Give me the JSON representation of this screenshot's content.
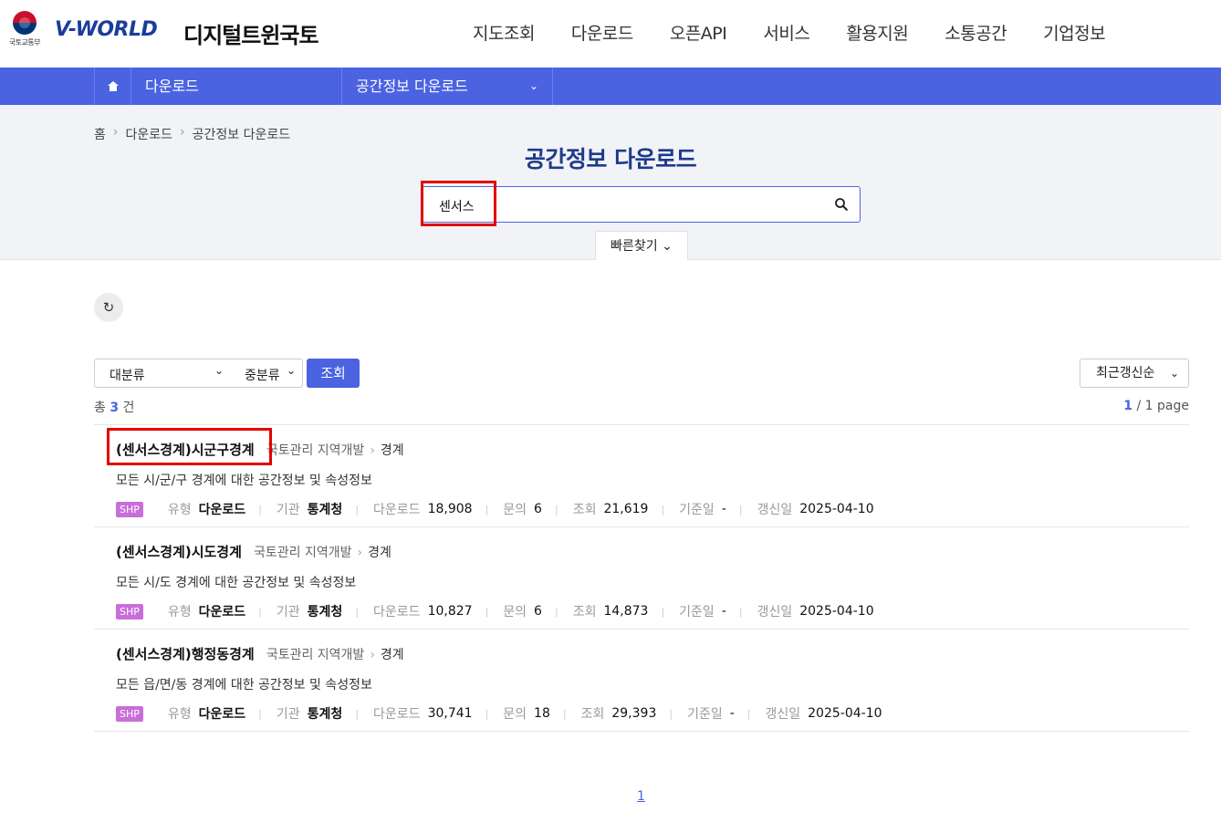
{
  "header": {
    "ministry_name": "국토교통부",
    "logo_text": "V-WORLD",
    "sub_brand": "디지털트윈국토",
    "nav": [
      "지도조회",
      "다운로드",
      "오픈API",
      "서비스",
      "활용지원",
      "소통공간",
      "기업정보"
    ]
  },
  "subnav": {
    "level1": "다운로드",
    "level2": "공간정보 다운로드"
  },
  "breadcrumb": [
    "홈",
    "다운로드",
    "공간정보 다운로드"
  ],
  "page_title": "공간정보 다운로드",
  "search": {
    "value": "센서스"
  },
  "quick_find": "빠른찾기",
  "filters": {
    "major": "대분류",
    "middle": "중분류",
    "search_button": "조회",
    "sort": "최근갱신순"
  },
  "summary": {
    "total_prefix": "총",
    "total": "3",
    "total_suffix": "건",
    "page_current": "1",
    "page_rest": "/ 1 page"
  },
  "results": [
    {
      "title": "(센서스경계)시군구경계",
      "cat1": "국토관리 지역개발",
      "cat2": "경계",
      "desc": "모든 시/군/구 경계에 대한 공간정보 및 속성정보",
      "format": "SHP",
      "type": "다운로드",
      "org": "통계청",
      "downloads": "18,908",
      "inquiries": "6",
      "views": "21,619",
      "base_date": "-",
      "updated": "2025-04-10"
    },
    {
      "title": "(센서스경계)시도경계",
      "cat1": "국토관리 지역개발",
      "cat2": "경계",
      "desc": "모든 시/도 경계에 대한 공간정보 및 속성정보",
      "format": "SHP",
      "type": "다운로드",
      "org": "통계청",
      "downloads": "10,827",
      "inquiries": "6",
      "views": "14,873",
      "base_date": "-",
      "updated": "2025-04-10"
    },
    {
      "title": "(센서스경계)행정동경계",
      "cat1": "국토관리 지역개발",
      "cat2": "경계",
      "desc": "모든 읍/면/동 경계에 대한 공간정보 및 속성정보",
      "format": "SHP",
      "type": "다운로드",
      "org": "통계청",
      "downloads": "30,741",
      "inquiries": "18",
      "views": "29,393",
      "base_date": "-",
      "updated": "2025-04-10"
    }
  ],
  "meta_labels": {
    "type": "유형",
    "org": "기관",
    "downloads": "다운로드",
    "inquiries": "문의",
    "views": "조회",
    "base_date": "기준일",
    "updated": "갱신일"
  },
  "pagination": [
    "1"
  ],
  "colors": {
    "brand_blue": "#4b63e1",
    "title_blue": "#1f3a8a",
    "highlight_red": "#e30000",
    "shp_badge": "#c86ed8"
  }
}
